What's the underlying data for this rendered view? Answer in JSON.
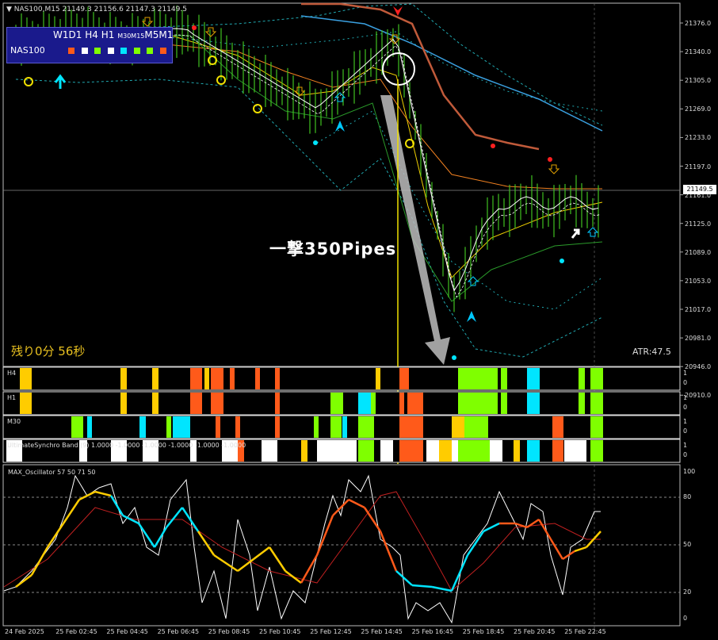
{
  "header": {
    "chart_title": "NAS100,M15  21149.3 21156.6 21147.3 21149.5"
  },
  "timeframe_panel": {
    "labels": [
      "W1",
      "D1",
      "H4",
      "H1",
      "M30",
      "M15",
      "M5",
      "M1"
    ],
    "symbol": "NAS100",
    "squares": [
      "#ff5a1a",
      "#ffffff",
      "#7fff00",
      "#ffffff",
      "#00e5ff",
      "#7fff00",
      "#7fff00",
      "#ff5a1a"
    ]
  },
  "countdown": "残り0分 56秒",
  "atr": "ATR:47.5",
  "annotation": "一撃350Pipes",
  "price_axis": {
    "ticks": [
      "21376.0",
      "21340.0",
      "21305.0",
      "21269.0",
      "21233.0",
      "21197.0",
      "21161.0",
      "21125.0",
      "21089.0",
      "21053.0",
      "21017.0",
      "20981.0",
      "20946.0",
      "20910.0"
    ],
    "current": "21149.5"
  },
  "strips": [
    {
      "label": "H4",
      "hi": "1",
      "lo": "0"
    },
    {
      "label": "H1",
      "hi": "1",
      "lo": "0"
    },
    {
      "label": "M30",
      "hi": "1",
      "lo": "0"
    },
    {
      "label": "UltimateSynchro Band (9) 1.0000 -1.0000 -1.0000 -1.0000 -1.0000 -1.0000",
      "hi": "1",
      "lo": "0"
    }
  ],
  "oscillator": {
    "label": "MAX_Oscillator 57 50 71 50",
    "ticks": [
      "100",
      "80",
      "50",
      "20",
      "0"
    ]
  },
  "time_axis": [
    "24 Feb 2025",
    "25 Feb 02:45",
    "25 Feb 04:45",
    "25 Feb 06:45",
    "25 Feb 08:45",
    "25 Feb 10:45",
    "25 Feb 12:45",
    "25 Feb 14:45",
    "25 Feb 16:45",
    "25 Feb 18:45",
    "25 Feb 20:45",
    "25 Feb 22:45"
  ],
  "colors": {
    "orange": "#ff5a1a",
    "yellow": "#ffcc00",
    "green": "#7fff00",
    "cyan": "#00e5ff",
    "white": "#ffffff"
  }
}
